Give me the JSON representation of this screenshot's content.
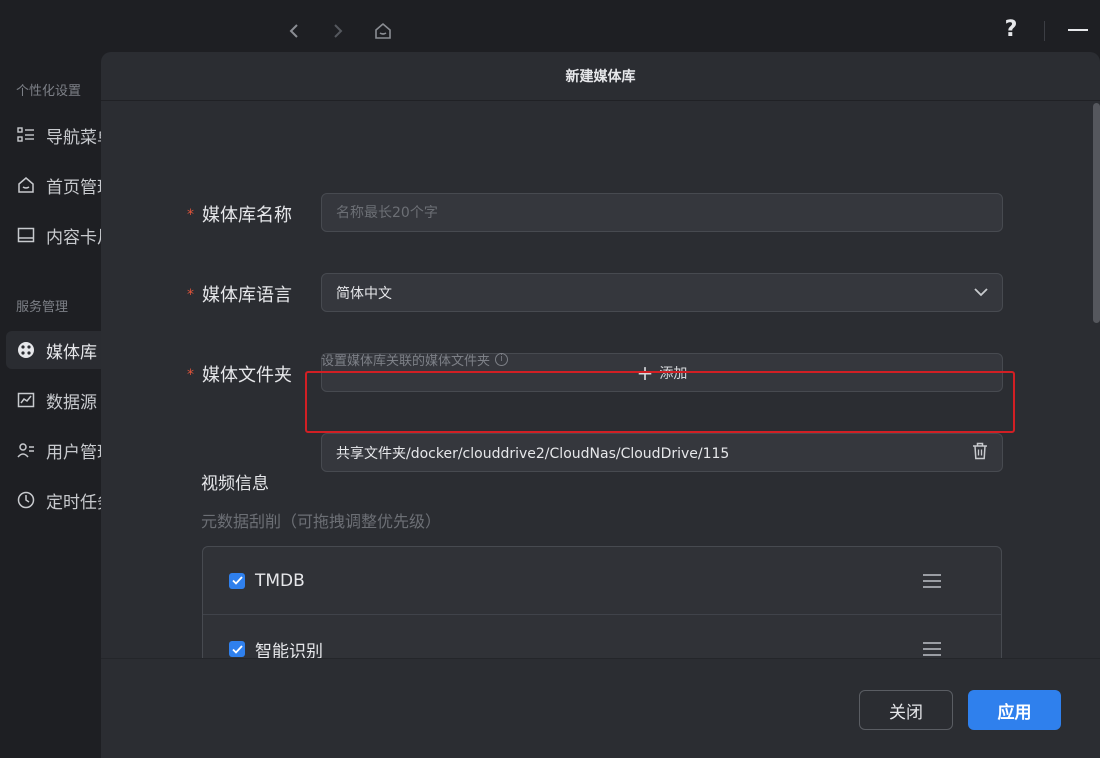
{
  "topbar": {
    "help_label": "?"
  },
  "sidebar": {
    "sections": [
      {
        "label": "个性化设置"
      },
      {
        "label": "服务管理"
      }
    ],
    "items": [
      {
        "label": "导航菜单",
        "icon": "list-icon"
      },
      {
        "label": "首页管理",
        "icon": "home-icon"
      },
      {
        "label": "内容卡片",
        "icon": "card-icon"
      },
      {
        "label": "媒体库",
        "icon": "media-library-icon",
        "active": true
      },
      {
        "label": "数据源",
        "icon": "chart-icon"
      },
      {
        "label": "用户管理",
        "icon": "users-icon"
      },
      {
        "label": "定时任务",
        "icon": "clock-icon"
      }
    ]
  },
  "modal": {
    "title": "新建媒体库",
    "name": {
      "label": "媒体库名称",
      "value": "",
      "placeholder": "名称最长20个字"
    },
    "language": {
      "label": "媒体库语言",
      "value": "简体中文"
    },
    "folder": {
      "label": "媒体文件夹",
      "add_label": "添加",
      "hint": "设置媒体库关联的媒体文件夹",
      "paths": [
        "共享文件夹/docker/clouddrive2/CloudNas/CloudDrive/115"
      ]
    },
    "video_info": {
      "title": "视频信息",
      "subtitle": "元数据刮削（可拖拽调整优先级）",
      "sources": [
        {
          "label": "TMDB",
          "checked": true
        },
        {
          "label": "智能识别",
          "checked": true
        }
      ]
    },
    "footer": {
      "close_label": "关闭",
      "apply_label": "应用"
    }
  },
  "colors": {
    "accent": "#2f80ed",
    "required": "#e2553b",
    "highlight": "#d11f24"
  }
}
